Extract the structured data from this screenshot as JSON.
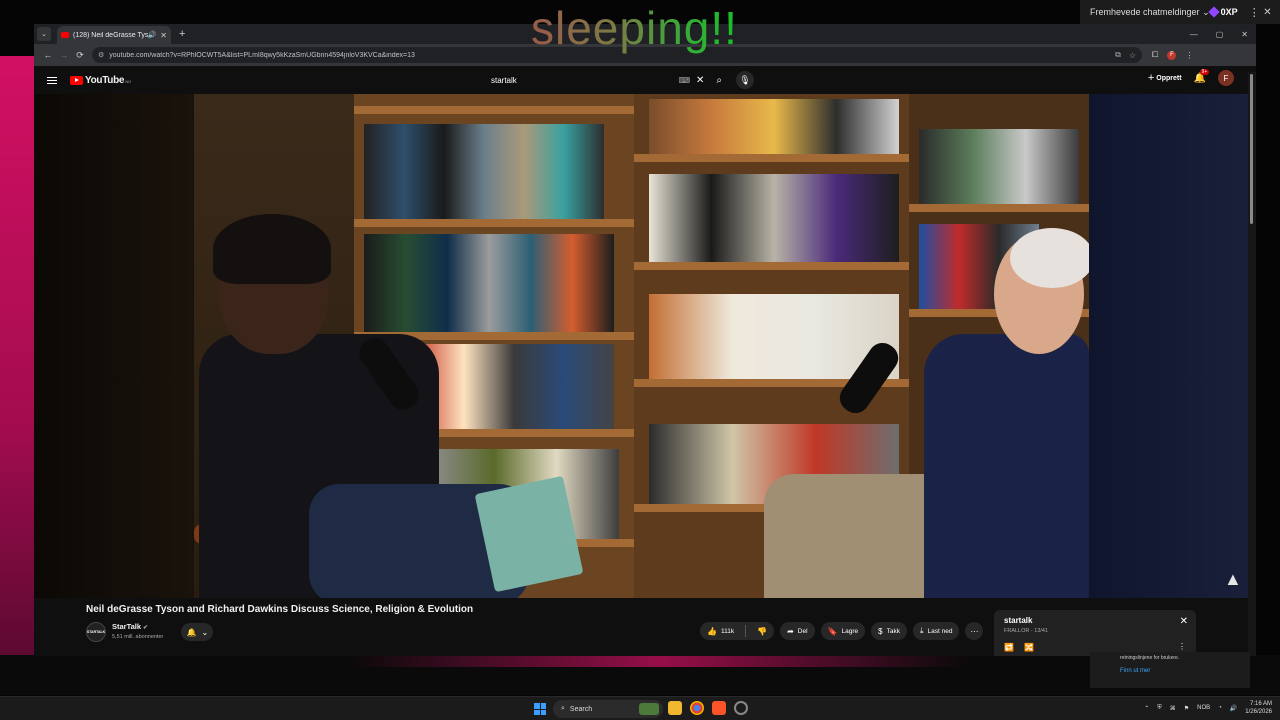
{
  "overlay": {
    "text": "sleeping!!"
  },
  "chat_widget": {
    "label": "Fremhevede chatmeldinger",
    "points": "0XP"
  },
  "browser": {
    "tab_title": "(128) Neil deGrasse Tyson a",
    "url": "youtube.com/watch?v=RPhlOCWT5A&list=PLmI8qwy5kKzaSmUGbnn4594jnloV3KVCa&index=13"
  },
  "youtube": {
    "logo": "YouTube",
    "logo_region": "NO",
    "search_query": "startalk",
    "create_label": "Opprett",
    "notifications_badge": "9+",
    "avatar_letter": "F"
  },
  "video": {
    "title": "Neil deGrasse Tyson and Richard Dawkins Discuss Science, Religion & Evolution",
    "watermark": "StarTalk logo"
  },
  "channel": {
    "avatar_text": "STARTALK",
    "name": "StarTalk",
    "subscribers": "5,51 mill. abonnenter"
  },
  "actions": {
    "likes": "111k",
    "share": "Del",
    "save": "Lagre",
    "thanks": "Takk",
    "download": "Last ned"
  },
  "playlist": {
    "title": "startalk",
    "subtitle": "FRALLOR - 13/41"
  },
  "behind_card": {
    "text1": "retningslinjene for brukere.",
    "link": "Finn ut mer"
  },
  "taskbar": {
    "search_label": "Search",
    "lang": "NOB",
    "time": "7:16 AM",
    "date": "1/26/2026"
  },
  "colors": {
    "youtube_red": "#ff0000",
    "accent_blue": "#3ea6ff",
    "brand_pink": "#d21063"
  }
}
